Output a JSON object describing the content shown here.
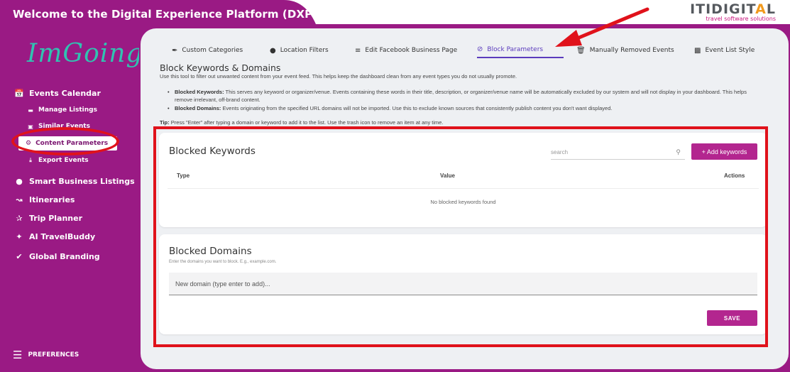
{
  "header": {
    "title": "Welcome to the Digital Experience Platform (DXP)",
    "brand_name_a": "ITIDIGIT",
    "brand_name_b": "L",
    "brand_tagline": "travel software solutions"
  },
  "sidebar": {
    "logo_text": "ImGoing",
    "items": [
      {
        "label": "Events Calendar",
        "icon": "calendar-icon"
      },
      {
        "label": "Manage Listings",
        "icon": "list-icon"
      },
      {
        "label": "Similar Events",
        "icon": "copy-icon"
      },
      {
        "label": "Content Parameters",
        "icon": "gear-icon"
      },
      {
        "label": "Export Events",
        "icon": "download-icon"
      },
      {
        "label": "Smart Business Listings",
        "icon": "map-pin-icon"
      },
      {
        "label": "Itineraries",
        "icon": "route-icon"
      },
      {
        "label": "Trip Planner",
        "icon": "hiker-icon"
      },
      {
        "label": "AI TravelBuddy",
        "icon": "sparkle-icon"
      },
      {
        "label": "Global Branding",
        "icon": "badge-icon"
      }
    ],
    "preferences_label": "PREFERENCES"
  },
  "tabs": [
    {
      "label": "Custom Categories",
      "icon": "magic-wand-icon"
    },
    {
      "label": "Location Filters",
      "icon": "map-pin-icon"
    },
    {
      "label": "Edit Facebook Business Page",
      "icon": "list-icon"
    },
    {
      "label": "Block Parameters",
      "icon": "block-icon",
      "active": true
    },
    {
      "label": "Manually Removed Events",
      "icon": "trash-icon"
    },
    {
      "label": "Event List Style",
      "icon": "window-icon"
    }
  ],
  "page": {
    "heading": "Block Keywords & Domains",
    "intro": "Use this tool to filter out unwanted content from your event feed. This helps keep the dashboard clean from any event types you do not usually promote.",
    "bullet1_title": "Blocked Keywords:",
    "bullet1_text": " This serves any keyword or organizer/venue. Events containing these words in their title, description, or organizer/venue name will be automatically excluded by our system and will not display in your dashboard. This helps remove irrelevant, off-brand content.",
    "bullet2_title": "Blocked Domains:",
    "bullet2_text": " Events originating from the specified URL domains will not be imported. Use this to exclude known sources that consistently publish content you don't want displayed.",
    "tip_label": "Tip:",
    "tip_text": " Press \"Enter\" after typing a domain or keyword to add it to the list. Use the trash icon to remove an item at any time."
  },
  "keywords_card": {
    "title": "Blocked Keywords",
    "search_placeholder": "search",
    "add_button": "+ Add keywords",
    "columns": [
      "Type",
      "Value",
      "Actions"
    ],
    "empty_text": "No blocked keywords found"
  },
  "domains_card": {
    "title": "Blocked Domains",
    "hint": "Enter the domains you want to block. E.g., example.com.",
    "input_placeholder": "New domain (type enter to add)...",
    "save_button": "SAVE"
  },
  "colors": {
    "brand_purple": "#9a1a84",
    "button_magenta": "#b3268f",
    "annotation_red": "#e0121b",
    "logo_teal": "#31c2b1"
  }
}
